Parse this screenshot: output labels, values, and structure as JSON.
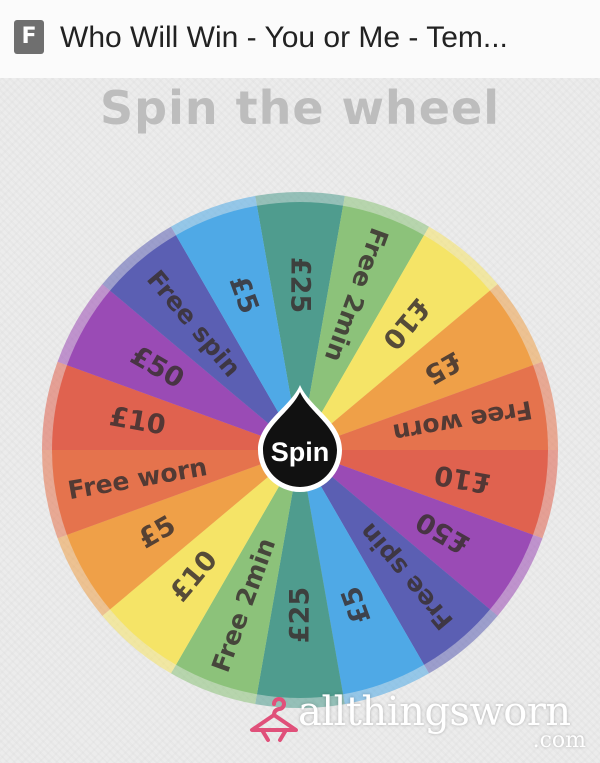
{
  "browser": {
    "tab_icon_glyph": "F",
    "tab_title": "Who Will Win - You or Me - Tem..."
  },
  "heading": "Spin the wheel",
  "wheel": {
    "spin_label": "Spin",
    "segments": [
      {
        "label": "£25",
        "color": "#4f9c8e"
      },
      {
        "label": "Free 2min",
        "color": "#8cc27a"
      },
      {
        "label": "£10",
        "color": "#f5e467"
      },
      {
        "label": "£5",
        "color": "#efa048"
      },
      {
        "label": "Free worn",
        "color": "#e5734d"
      },
      {
        "label": "£10",
        "color": "#e0624f"
      },
      {
        "label": "£50",
        "color": "#9a4bb5"
      },
      {
        "label": "Free spin",
        "color": "#5b5fb3"
      },
      {
        "label": "£5",
        "color": "#4fa9e6"
      },
      {
        "label": "£25",
        "color": "#4f9c8e"
      },
      {
        "label": "Free 2min",
        "color": "#8cc27a"
      },
      {
        "label": "£10",
        "color": "#f5e467"
      },
      {
        "label": "£5",
        "color": "#efa048"
      },
      {
        "label": "Free worn",
        "color": "#e5734d"
      },
      {
        "label": "£10",
        "color": "#e0624f"
      },
      {
        "label": "£50",
        "color": "#9a4bb5"
      },
      {
        "label": "Free spin",
        "color": "#5b5fb3"
      },
      {
        "label": "£5",
        "color": "#4fa9e6"
      }
    ]
  },
  "watermark": {
    "brand": "allthingsworn",
    "domain": ".com",
    "color": "#e0507a"
  }
}
